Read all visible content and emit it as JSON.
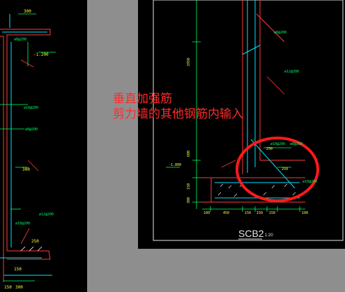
{
  "annotation": {
    "line1": "垂直加强筋",
    "line2": "剪力墙的其他钢筋内输入"
  },
  "left_drawing": {
    "labels": {
      "top_dim": "300",
      "dim_a": "150",
      "dim_b": "150",
      "dim_c": "300",
      "dim_d": "300",
      "dim_e": "250",
      "dim_f": "300",
      "elev": "-1.200",
      "rebar_1": "⌀8@200",
      "rebar_2": "⌀10@200",
      "rebar_3": "⌀8@200",
      "rebar_4": "⌀12@200",
      "rebar_5": "⌀10@200"
    }
  },
  "right_drawing": {
    "labels": {
      "rebar_top": "⌀8@200",
      "rebar_mid": "⌀12@200",
      "rebar_r1": "⌀10@200",
      "rebar_r2": "⌀8@200",
      "rebar_foot": "⌀10@200",
      "dim_v1": "2950",
      "dim_v2": "600",
      "dim_v3": "150",
      "dim_v4": "300",
      "dim_250": "250",
      "dim_250b": "250",
      "elev": "-1.800",
      "b1": "100",
      "b2": "450",
      "b3": "150",
      "b4": "150",
      "b5": "150",
      "b6": "100"
    },
    "section_title": "SCB2",
    "section_scale": "1:20"
  },
  "colors": {
    "highlight": "#ff1a1a",
    "wall": "#ff3b3b",
    "rebar": "#00e5ff",
    "dim": "#00ff66",
    "label": "#ffff33",
    "frame": "#e6e6e6"
  }
}
